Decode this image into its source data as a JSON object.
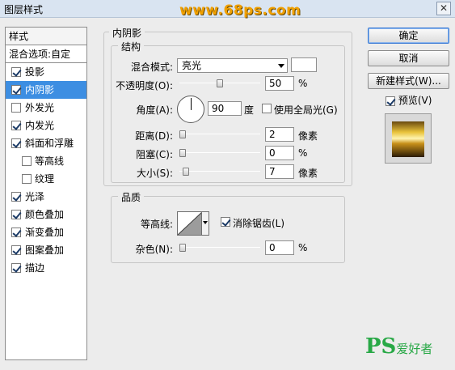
{
  "window": {
    "title": "图层样式",
    "watermark": "www.68ps.com",
    "close_glyph": "✕"
  },
  "left_panel": {
    "header": "样式",
    "blend_options": "混合选项:自定",
    "items": [
      {
        "label": "投影",
        "checked": true,
        "sub": false,
        "selected": false
      },
      {
        "label": "内阴影",
        "checked": true,
        "sub": false,
        "selected": true
      },
      {
        "label": "外发光",
        "checked": false,
        "sub": false,
        "selected": false
      },
      {
        "label": "内发光",
        "checked": true,
        "sub": false,
        "selected": false
      },
      {
        "label": "斜面和浮雕",
        "checked": true,
        "sub": false,
        "selected": false
      },
      {
        "label": "等高线",
        "checked": false,
        "sub": true,
        "selected": false
      },
      {
        "label": "纹理",
        "checked": false,
        "sub": true,
        "selected": false
      },
      {
        "label": "光泽",
        "checked": true,
        "sub": false,
        "selected": false
      },
      {
        "label": "颜色叠加",
        "checked": true,
        "sub": false,
        "selected": false
      },
      {
        "label": "渐变叠加",
        "checked": true,
        "sub": false,
        "selected": false
      },
      {
        "label": "图案叠加",
        "checked": true,
        "sub": false,
        "selected": false
      },
      {
        "label": "描边",
        "checked": true,
        "sub": false,
        "selected": false
      }
    ]
  },
  "inner_shadow": {
    "title": "内阴影",
    "structure": {
      "title": "结构",
      "blend_mode_label": "混合模式:",
      "blend_mode_value": "亮光",
      "blend_color": "#ffffff",
      "opacity_label": "不透明度(O):",
      "opacity_value": "50",
      "opacity_unit": "%",
      "angle_label": "角度(A):",
      "angle_value": "90",
      "angle_unit": "度",
      "global_light_label": "使用全局光(G)",
      "global_light_checked": false,
      "distance_label": "距离(D):",
      "distance_value": "2",
      "distance_unit": "像素",
      "choke_label": "阻塞(C):",
      "choke_value": "0",
      "choke_unit": "%",
      "size_label": "大小(S):",
      "size_value": "7",
      "size_unit": "像素"
    },
    "quality": {
      "title": "品质",
      "contour_label": "等高线:",
      "antialias_label": "消除锯齿(L)",
      "antialias_checked": true,
      "noise_label": "杂色(N):",
      "noise_value": "0",
      "noise_unit": "%"
    }
  },
  "buttons": {
    "ok": "确定",
    "cancel": "取消",
    "new_style": "新建样式(W)..."
  },
  "preview": {
    "label": "预览(V)",
    "checked": true
  },
  "watermark_bottom": {
    "ps": "PS",
    "text": "爱好者"
  }
}
